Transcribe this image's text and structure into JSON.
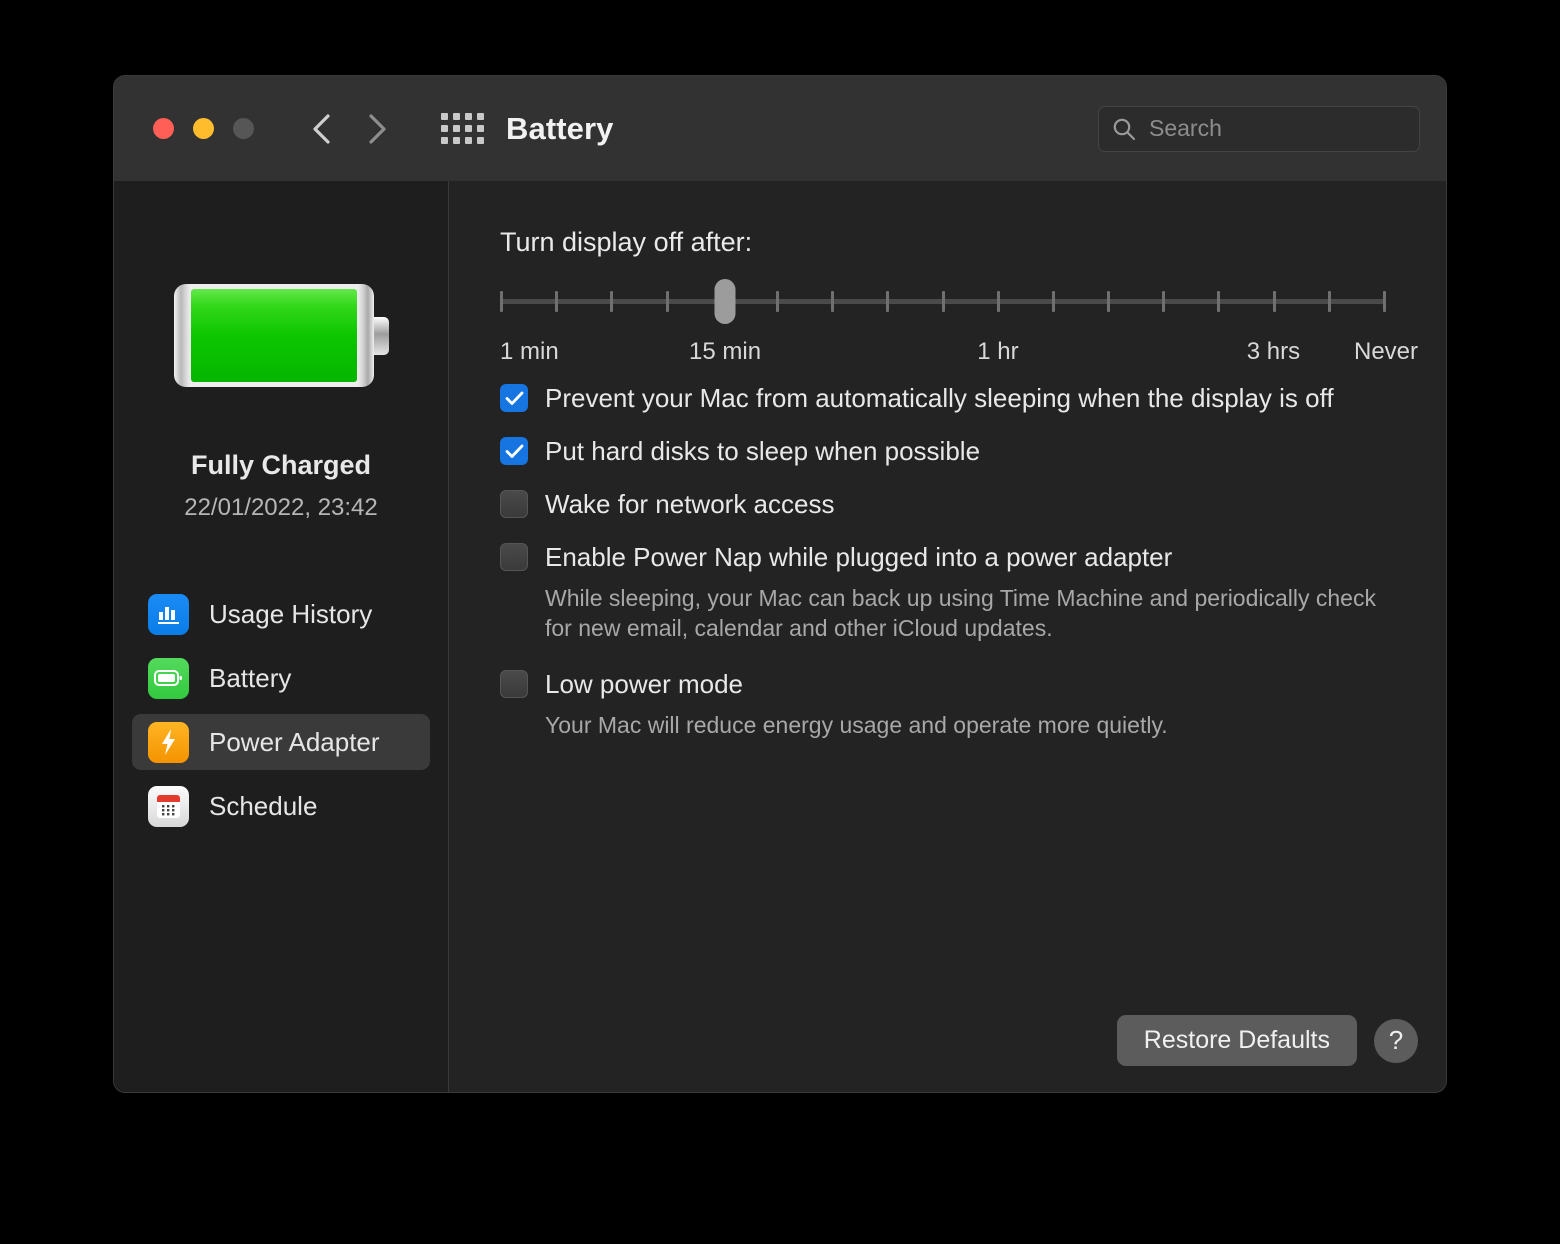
{
  "window": {
    "title": "Battery",
    "traffic_lights": [
      "close",
      "minimize",
      "zoom"
    ],
    "back_icon": "chevron-left-icon",
    "forward_icon": "chevron-right-icon",
    "grid_icon": "grid-apps-icon"
  },
  "search": {
    "placeholder": "Search",
    "value": "",
    "icon": "search-icon"
  },
  "sidebar": {
    "battery": {
      "icon": "battery-full-icon",
      "status": "Fully Charged",
      "timestamp": "22/01/2022, 23:42"
    },
    "items": [
      {
        "label": "Usage History",
        "icon": "usage-history-icon",
        "selected": false
      },
      {
        "label": "Battery",
        "icon": "battery-icon",
        "selected": false
      },
      {
        "label": "Power Adapter",
        "icon": "power-adapter-icon",
        "selected": true
      },
      {
        "label": "Schedule",
        "icon": "schedule-calendar-icon",
        "selected": false
      }
    ]
  },
  "main": {
    "slider_title": "Turn display off after:",
    "slider": {
      "value_label": "15 min",
      "thumb_percent": 25.4,
      "tick_count": 17,
      "labels": [
        {
          "text": "1 min",
          "percent": 0
        },
        {
          "text": "15 min",
          "percent": 25.4
        },
        {
          "text": "1 hr",
          "percent": 56.2
        },
        {
          "text": "3 hrs",
          "percent": 87.3
        },
        {
          "text": "Never",
          "percent": 100
        }
      ]
    },
    "options": [
      {
        "label": "Prevent your Mac from automatically sleeping when the display is off",
        "checked": true,
        "description": ""
      },
      {
        "label": "Put hard disks to sleep when possible",
        "checked": true,
        "description": ""
      },
      {
        "label": "Wake for network access",
        "checked": false,
        "description": ""
      },
      {
        "label": "Enable Power Nap while plugged into a power adapter",
        "checked": false,
        "description": "While sleeping, your Mac can back up using Time Machine and periodically check for new email, calendar and other iCloud updates."
      },
      {
        "label": "Low power mode",
        "checked": false,
        "description": "Your Mac will reduce energy usage and operate more quietly."
      }
    ],
    "restore_label": "Restore Defaults",
    "help_label": "?"
  },
  "colors": {
    "accent_blue": "#1675e0",
    "battery_green": "#0dc600",
    "adapter_orange": "#f59300",
    "window_bg": "#232323",
    "sidebar_bg": "#1e1e1e",
    "titlebar_bg": "#323232"
  }
}
